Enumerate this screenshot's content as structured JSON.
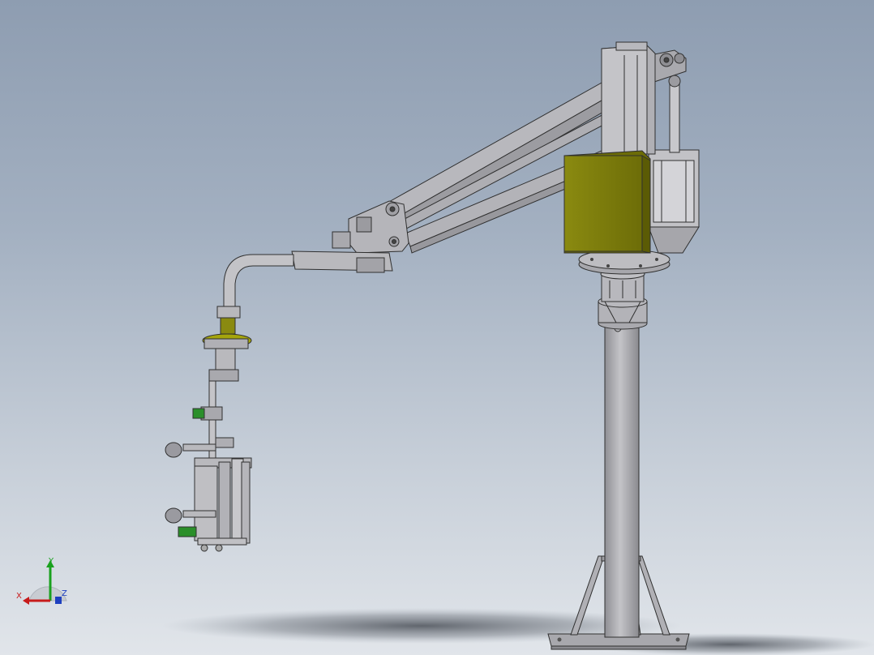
{
  "viewport": {
    "background_top": "#8e9db1",
    "background_bottom": "#e1e5ea"
  },
  "model": {
    "part_color": "#b5b5b9",
    "edge_color": "#303030",
    "yellow_color": "#7f7f0a",
    "green_color": "#2a8f2a"
  },
  "triad": {
    "x_label": "X",
    "y_label": "Y",
    "z_label": "Z",
    "x_color": "#c71b1b",
    "y_color": "#19a11e",
    "z_color": "#1d3fbf"
  }
}
